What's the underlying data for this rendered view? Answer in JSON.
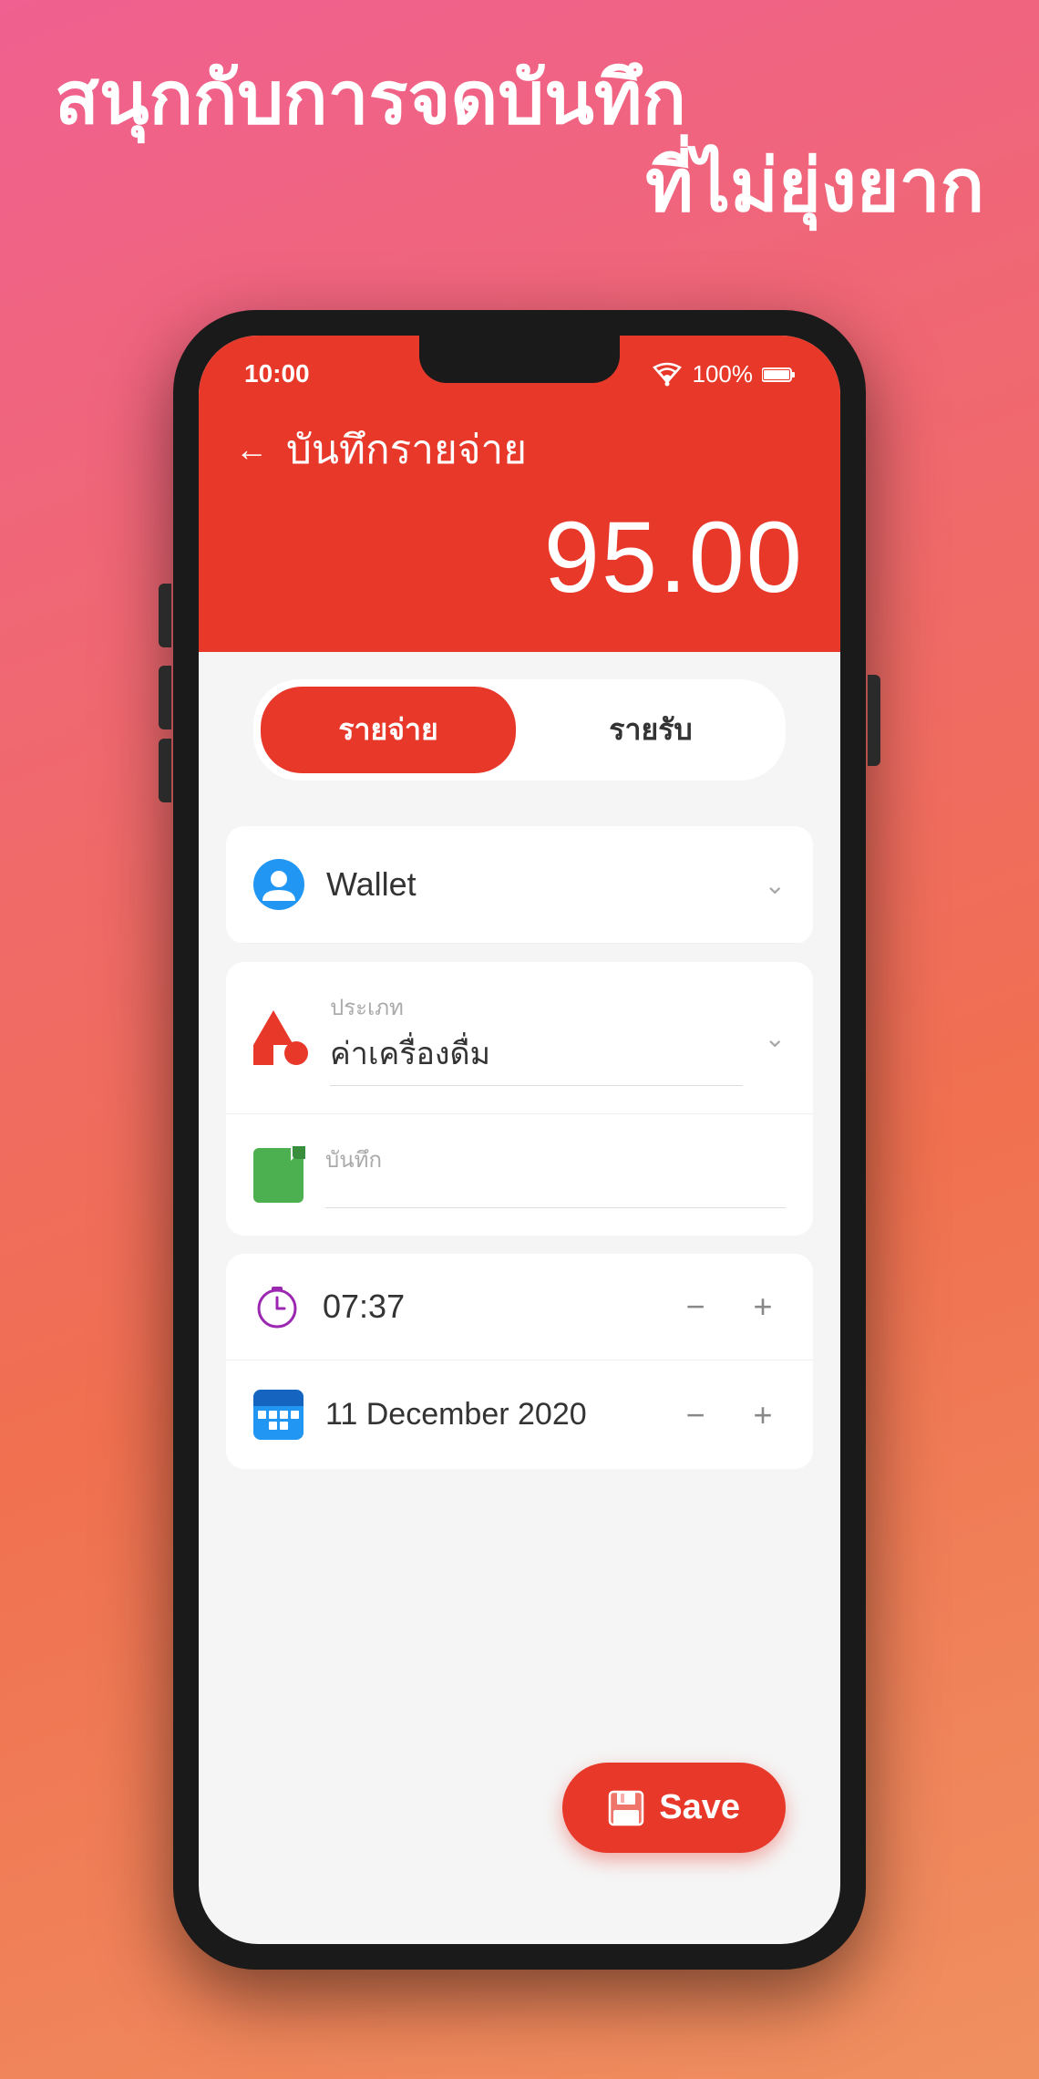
{
  "tagline": {
    "line1": "สนุกกับการจดบันทึก",
    "line2": "ที่ไม่ยุ่งยาก"
  },
  "status_bar": {
    "time": "10:00",
    "signal": "WiFi",
    "battery": "100%"
  },
  "header": {
    "back_label": "←",
    "title": "บันทึกรายจ่าย",
    "amount": "95.00"
  },
  "tabs": {
    "expense_label": "รายจ่าย",
    "income_label": "รายรับ",
    "active": "expense"
  },
  "wallet_field": {
    "value": "Wallet"
  },
  "category_field": {
    "label": "ประเภท",
    "value": "ค่าเครื่องดื่ม"
  },
  "note_field": {
    "label": "บันทึก",
    "placeholder": ""
  },
  "time_field": {
    "value": "07:37"
  },
  "date_field": {
    "value": "11 December 2020"
  },
  "save_button": {
    "label": "Save"
  },
  "stepper": {
    "minus": "−",
    "plus": "+"
  }
}
